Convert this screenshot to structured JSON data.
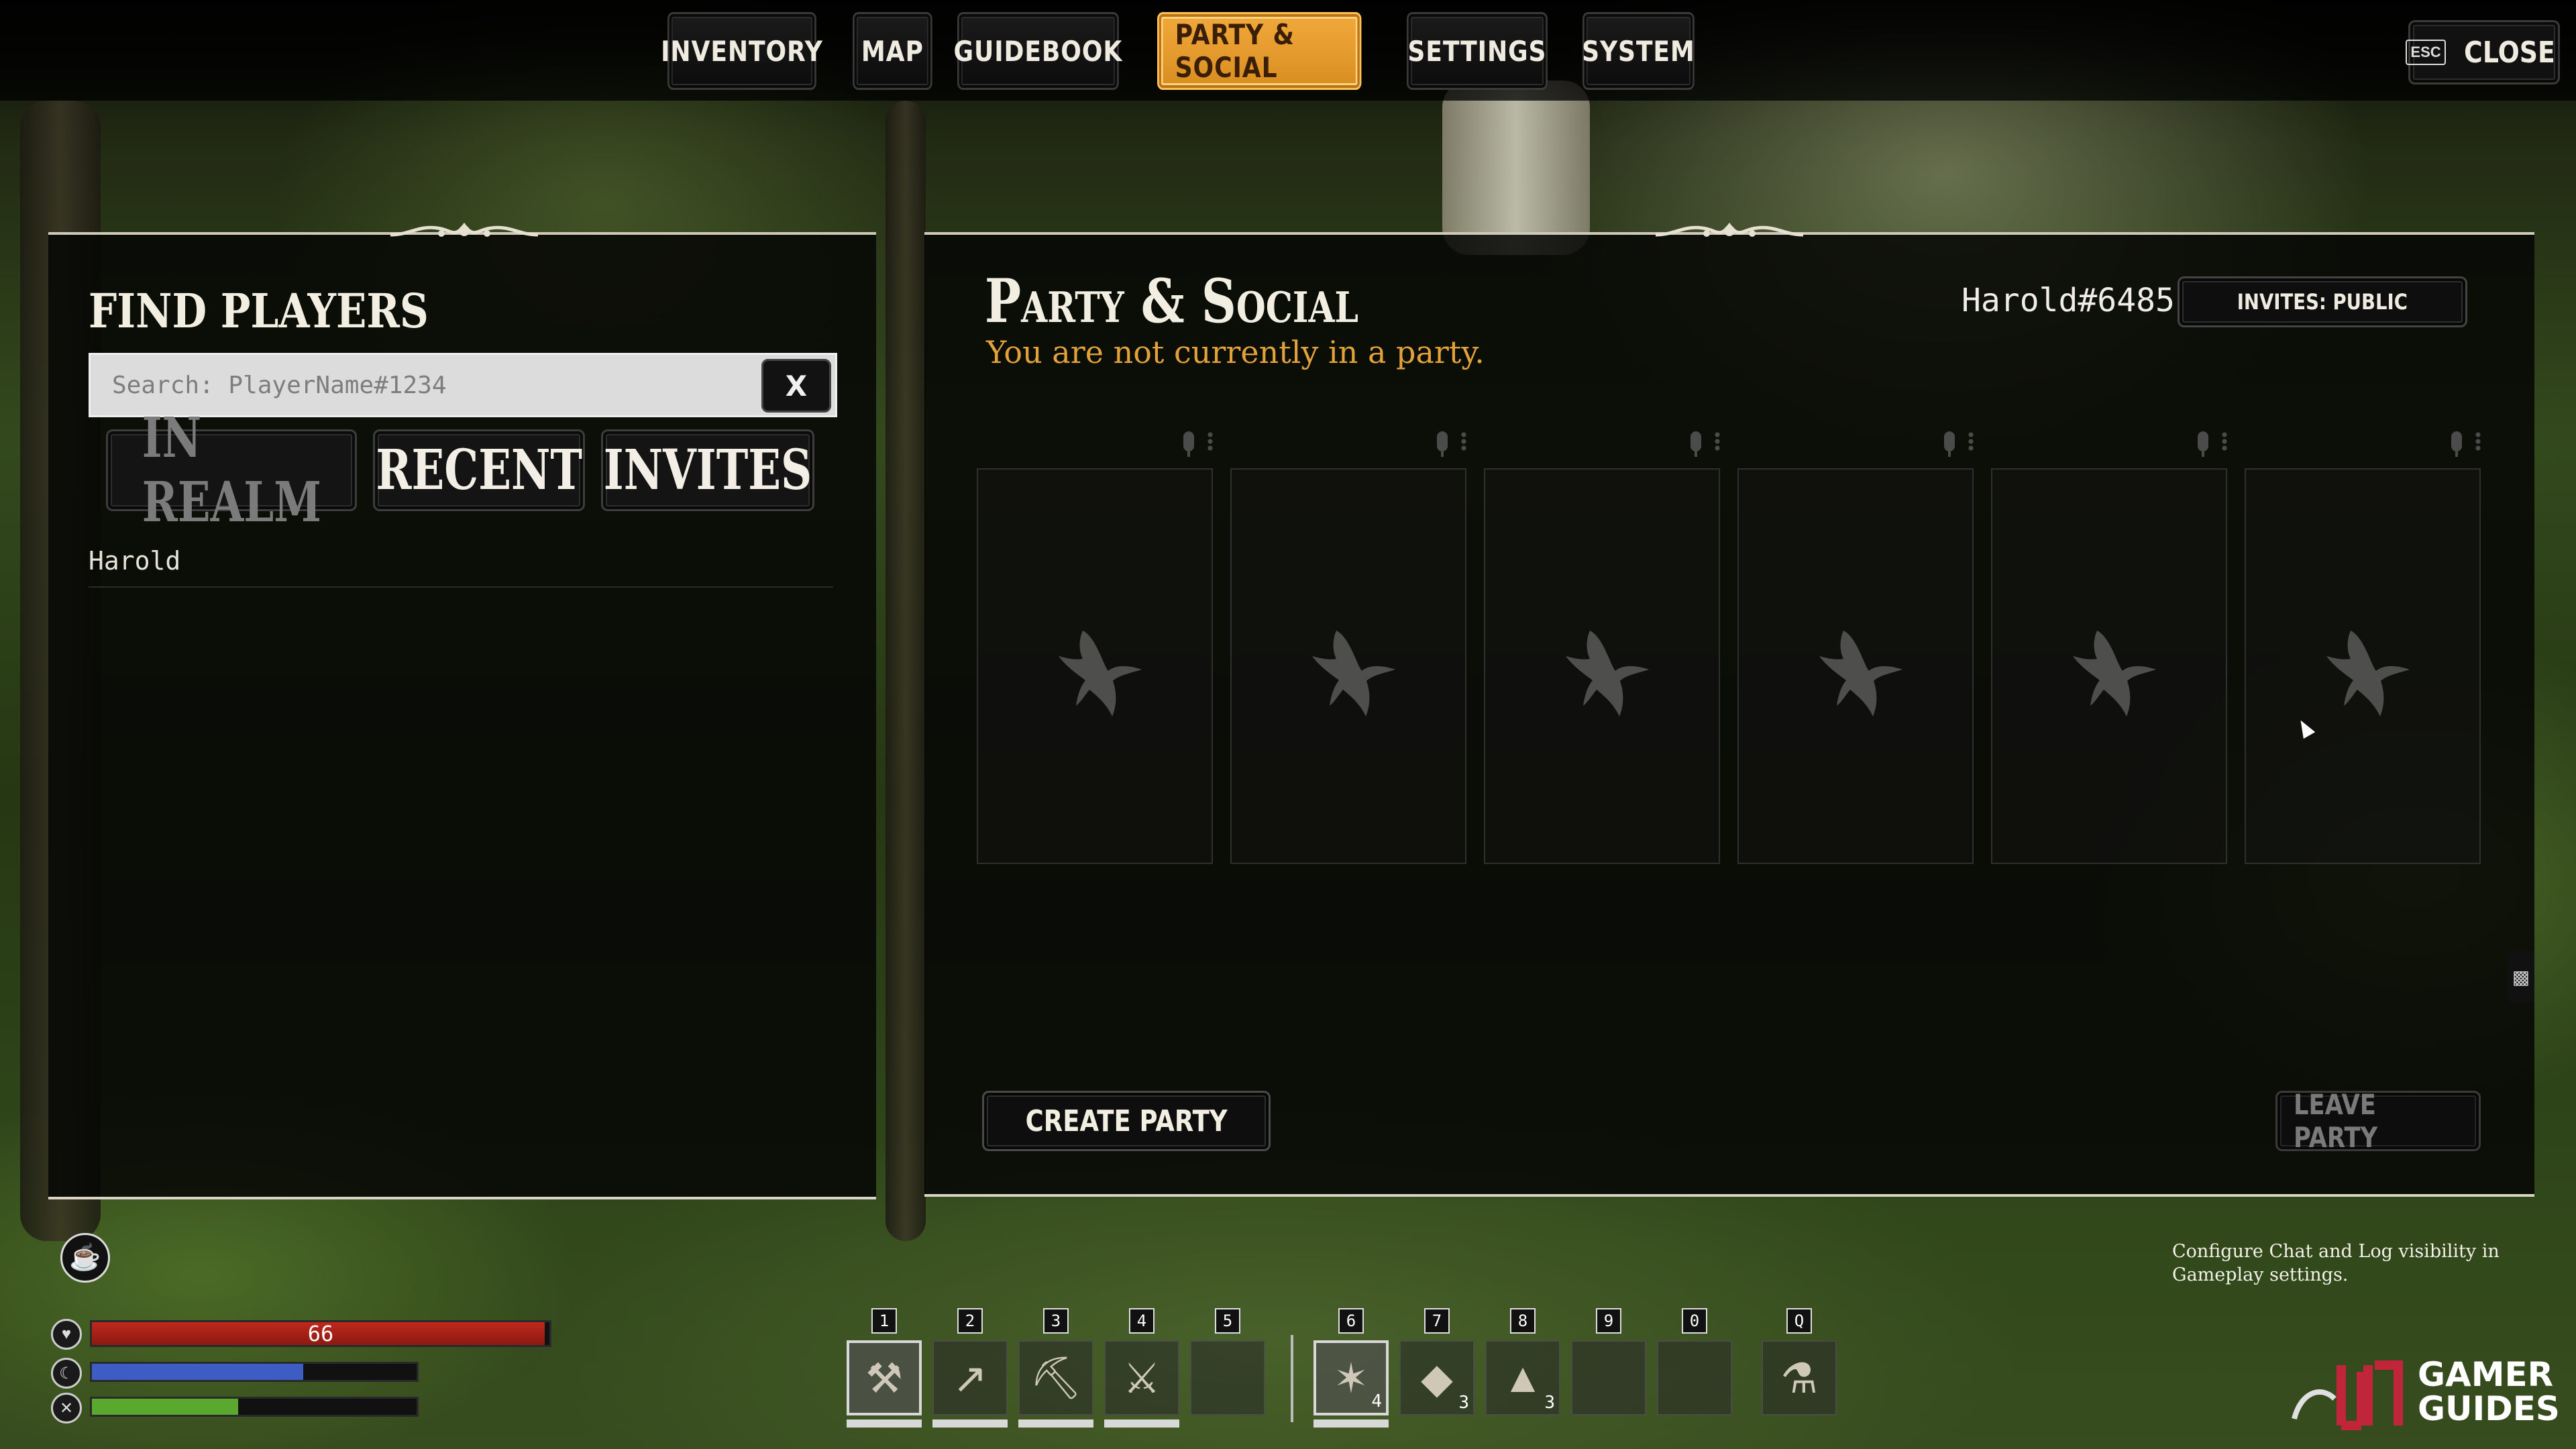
{
  "nav": {
    "tabs": [
      {
        "label": "INVENTORY",
        "active": false
      },
      {
        "label": "MAP",
        "active": false
      },
      {
        "label": "GUIDEBOOK",
        "active": false
      },
      {
        "label": "PARTY & SOCIAL",
        "active": true
      },
      {
        "label": "SETTINGS",
        "active": false
      },
      {
        "label": "SYSTEM",
        "active": false
      }
    ],
    "close": {
      "key": "ESC",
      "label": "CLOSE"
    }
  },
  "find_players": {
    "title": "FIND PLAYERS",
    "search": {
      "placeholder": "Search: PlayerName#1234",
      "value": "",
      "clear_label": "X"
    },
    "filters": [
      {
        "label": "IN REALM",
        "active": false
      },
      {
        "label": "RECENT",
        "active": true
      },
      {
        "label": "INVITES",
        "active": true
      }
    ],
    "players": [
      "Harold"
    ]
  },
  "party": {
    "title": "Party & Social",
    "status": "You are not currently in a party.",
    "user_tag": "Harold#6485",
    "invites_label": "INVITES: PUBLIC",
    "slot_count": 6,
    "slot_icon": "eagle-silhouette-icon",
    "create_label": "CREATE PARTY",
    "leave_label": "LEAVE PARTY"
  },
  "hud": {
    "health": {
      "value": "66",
      "fraction": 0.99,
      "color": "#c0281c"
    },
    "stamina": {
      "fraction": 0.65,
      "color": "#3d5cc4"
    },
    "hunger": {
      "fraction": 0.45,
      "color": "#5aa82e"
    },
    "hotbar": [
      {
        "key": "1",
        "icon": "stone-axe-icon",
        "selected": true,
        "count": ""
      },
      {
        "key": "2",
        "icon": "stone-spear-icon",
        "selected": false,
        "count": ""
      },
      {
        "key": "3",
        "icon": "pickaxe-icon",
        "selected": false,
        "count": ""
      },
      {
        "key": "4",
        "icon": "crossed-tools-icon",
        "selected": false,
        "count": ""
      },
      {
        "key": "5",
        "icon": "",
        "selected": false,
        "count": ""
      },
      {
        "key": "6",
        "icon": "torch-icon",
        "selected": true,
        "count": "4"
      },
      {
        "key": "7",
        "icon": "hide-icon",
        "selected": false,
        "count": "3"
      },
      {
        "key": "8",
        "icon": "flint-icon",
        "selected": false,
        "count": "3"
      },
      {
        "key": "9",
        "icon": "",
        "selected": false,
        "count": ""
      },
      {
        "key": "0",
        "icon": "",
        "selected": false,
        "count": ""
      },
      {
        "key": "Q",
        "icon": "flask-icon",
        "selected": false,
        "count": ""
      }
    ],
    "hint": "Configure Chat and Log visibility in Gameplay settings."
  },
  "watermark": {
    "line1": "GAMER",
    "line2": "GUIDES"
  }
}
